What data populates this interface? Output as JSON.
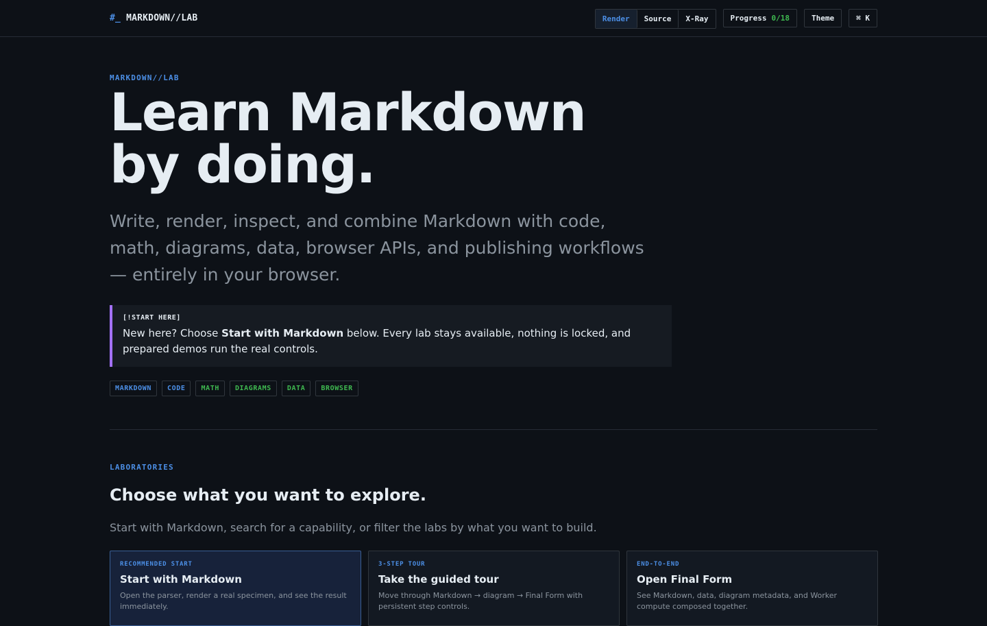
{
  "header": {
    "brand_prefix": "#_",
    "brand_name": "MARKDOWN//LAB",
    "view_modes": [
      "Render",
      "Source",
      "X-Ray"
    ],
    "active_view": "Render",
    "progress_label": "Progress",
    "progress_count": "0/18",
    "theme_label": "Theme",
    "command_label": "⌘ K"
  },
  "hero": {
    "eyebrow": "MARKDOWN//LAB",
    "title_line1": "Learn Markdown",
    "title_line2": "by doing.",
    "subtitle": "Write, render, inspect, and combine Markdown with code, math, diagrams, data, browser APIs, and publishing workflows — entirely in your browser.",
    "callout": {
      "tag": "[!START HERE]",
      "text_before": "New here? Choose ",
      "text_bold": "Start with Markdown",
      "text_after": " below. Every lab stays available, nothing is locked, and prepared demos run the real controls."
    },
    "chips": [
      {
        "label": "MARKDOWN",
        "color": "#4c8fe6"
      },
      {
        "label": "CODE",
        "color": "#4c8fe6"
      },
      {
        "label": "MATH",
        "color": "#3fb950"
      },
      {
        "label": "DIAGRAMS",
        "color": "#3fb950"
      },
      {
        "label": "DATA",
        "color": "#3fb950"
      },
      {
        "label": "BROWSER",
        "color": "#3fb950"
      }
    ]
  },
  "labs": {
    "eyebrow": "LABORATORIES",
    "title": "Choose what you want to explore.",
    "description": "Start with Markdown, search for a capability, or filter the labs by what you want to build.",
    "cards": [
      {
        "kicker": "RECOMMENDED START",
        "title": "Start with Markdown",
        "description": "Open the parser, render a real specimen, and see the result immediately."
      },
      {
        "kicker": "3-STEP TOUR",
        "title": "Take the guided tour",
        "description": "Move through Markdown → diagram → Final Form with persistent step controls."
      },
      {
        "kicker": "END-TO-END",
        "title": "Open Final Form",
        "description": "See Markdown, data, diagram metadata, and Worker compute composed together."
      }
    ]
  },
  "colors": {
    "background": "#0d1117",
    "accent_blue": "#4c8fe6",
    "accent_green": "#3fb950",
    "callout_border": "#a371f7"
  }
}
